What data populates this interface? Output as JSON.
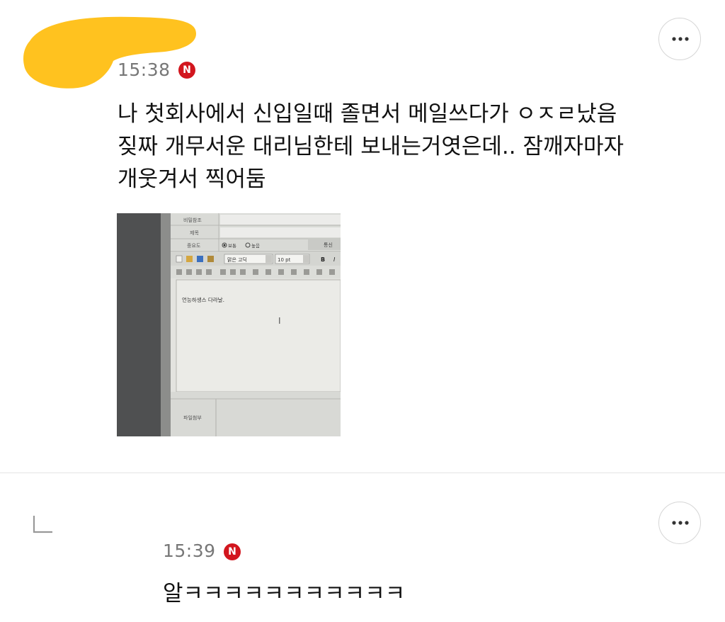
{
  "comment": {
    "time": "15:38",
    "badge": "N",
    "text": "나 첫회사에서 신입일때 졸면서 메일쓰다가 ㅇㅈㄹ났음\n짖짜 개무서운 대리님한테 보내는거엿은데.. 잠깨자마자\n개웃겨서 찍어둠",
    "more_icon": "more-dots-icon",
    "photo": {
      "form_labels": [
        "비밀참조",
        "제목",
        "중요도",
        "파일첨부"
      ],
      "priority_options": [
        "보통",
        "높음"
      ],
      "font_name": "맑은 고딕",
      "font_size": "10 pt",
      "bold_glyph": "B",
      "italic_glyph": "I",
      "send_label": "통신",
      "body_text": "언능하생스 다라날."
    }
  },
  "reply": {
    "time": "15:39",
    "badge": "N",
    "text": "알ㅋㅋㅋㅋㅋㅋㅋㅋㅋㅋㅋ",
    "reply_icon": "reply-arrow-icon",
    "more_icon": "more-dots-icon"
  },
  "colors": {
    "redaction": "#ffc21f",
    "badge": "#d2161e",
    "time": "#777777"
  }
}
